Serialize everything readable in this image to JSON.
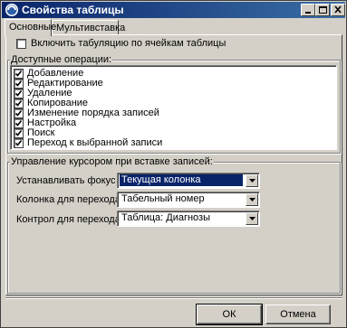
{
  "window": {
    "title": "Свойства таблицы",
    "app_icon": "app-circle-icon",
    "controls": [
      "minimize-icon",
      "maximize-icon",
      "close-icon"
    ]
  },
  "tabs": [
    {
      "label": "Основные",
      "active": true
    },
    {
      "label": "Мультивставка",
      "active": false
    }
  ],
  "tab_order": {
    "label": "Включить табуляцию по ячейкам таблицы",
    "checked": false
  },
  "operations": {
    "title": "Доступные операции:",
    "items": [
      {
        "label": "Добавление",
        "checked": true
      },
      {
        "label": "Редактирование",
        "checked": true
      },
      {
        "label": "Удаление",
        "checked": true
      },
      {
        "label": "Копирование",
        "checked": true
      },
      {
        "label": "Изменение порядка записей",
        "checked": true
      },
      {
        "label": "Настройка",
        "checked": true
      },
      {
        "label": "Поиск",
        "checked": true
      },
      {
        "label": "Переход к выбранной записи",
        "checked": true
      }
    ]
  },
  "cursor": {
    "title": "Управление курсором при вставке записей:",
    "focus": {
      "label": "Устанавливать фокус на:",
      "value": "Текущая колонка"
    },
    "column": {
      "label": "Колонка для перехода:",
      "value": "Табельный номер"
    },
    "control": {
      "label": "Контрол для перехода:",
      "value": "Таблица: Диагнозы"
    }
  },
  "buttons": {
    "ok": "ОК",
    "cancel": "Отмена"
  },
  "colors": {
    "titlebar_start": "#0a246a",
    "titlebar_end": "#3a6ea5",
    "face": "#d4d0c8",
    "selection": "#0a246a"
  }
}
